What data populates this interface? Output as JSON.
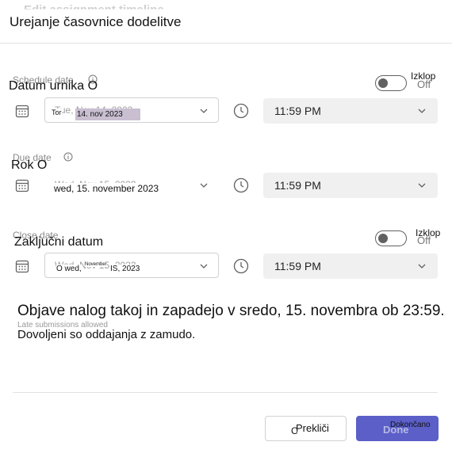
{
  "dialog": {
    "title": "Urejanje časovnice dodelitve",
    "title_ghost": "Edit assignment timeline"
  },
  "schedule": {
    "label": "Datum urnika O",
    "label_ghost": "Schedule date",
    "toggle_state": "Izklop",
    "toggle_ghost": "Off",
    "date_prefix": "Tor",
    "date_value": "14. nov 2023",
    "date_ghost": "Tue, Nov 14, 2023",
    "time_value": "11:59 PM"
  },
  "due": {
    "label": "Rok O",
    "label_ghost": "Due date",
    "date_value": "wed, 15. november 2023",
    "date_ghost": "Wed, Nov 15, 2023",
    "time_value": "11:59 PM"
  },
  "close": {
    "label": "Zaključni datum",
    "label_ghost": "Close date",
    "toggle_state": "Izklop",
    "toggle_ghost": "Off",
    "date_prefix": "O wed,",
    "date_month": "November",
    "date_suffix": "IS, 2023",
    "date_ghost": "Wed, Nov 15, 2023",
    "time_value": "11:59 PM"
  },
  "summary": {
    "text": "Objave nalog takoj in zapadejo v sredo, 15. novembra ob 23:59.",
    "late": "Dovoljeni so oddajanja z zamudo.",
    "late_ghost": "Late submissions allowed"
  },
  "buttons": {
    "cancel": "Prekliči",
    "cancel_prefix": "C",
    "done": "Dokončano",
    "done_ghost": "Done"
  },
  "icons": {
    "calendar": "calendar-icon",
    "clock": "clock-icon",
    "chevron": "chevron-down-icon",
    "info": "info-icon"
  },
  "colors": {
    "accent": "#5b5fc7",
    "time_field_bg": "#f0f0f0"
  }
}
